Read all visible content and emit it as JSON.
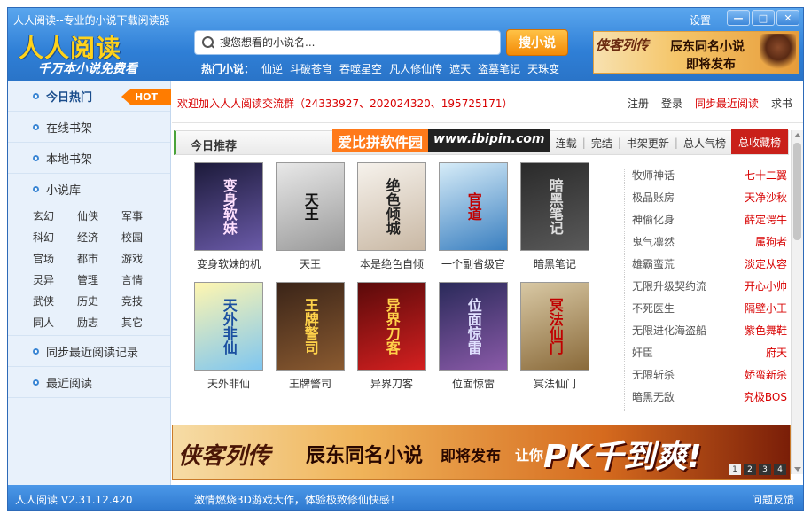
{
  "window": {
    "title": "人人阅读--专业的小说下载阅读器",
    "settings_label": "设置",
    "minimize": "—",
    "maximize": "□",
    "close": "✕"
  },
  "header": {
    "logo": "人人阅读",
    "slogan": "千万本小说免费看",
    "search_placeholder": "搜您想看的小说名...",
    "search_button": "搜小说",
    "hot_label": "热门小说：",
    "hot_words": [
      "仙逆",
      "斗破苍穹",
      "吞噬星空",
      "凡人修仙传",
      "遮天",
      "盗墓笔记",
      "天珠变"
    ],
    "ad": {
      "art": "侠客列传",
      "line1": "辰东同名小说",
      "line2": "即将发布"
    }
  },
  "sidebar": {
    "items": [
      {
        "label": "今日热门",
        "badge": "HOT"
      },
      {
        "label": "在线书架"
      },
      {
        "label": "本地书架"
      },
      {
        "label": "小说库"
      }
    ],
    "categories": [
      "玄幻",
      "仙侠",
      "军事",
      "科幻",
      "经济",
      "校园",
      "官场",
      "都市",
      "游戏",
      "灵异",
      "管理",
      "言情",
      "武侠",
      "历史",
      "竞技",
      "同人",
      "励志",
      "其它"
    ],
    "bottom_items": [
      {
        "label": "同步最近阅读记录"
      },
      {
        "label": "最近阅读"
      }
    ]
  },
  "main": {
    "notice": "欢迎加入人人阅读交流群（24333927、202024320、195725171）",
    "top_links": [
      "注册",
      "登录",
      "同步最近阅读",
      "求书"
    ],
    "rec_title": "今日推荐",
    "watermark": {
      "cn": "爱比拼软件园",
      "url": "www.ibipin.com"
    },
    "tabs": [
      "连载",
      "完结",
      "书架更新",
      "总人气榜",
      "总收藏榜"
    ],
    "books": [
      {
        "name": "变身软妹的机",
        "cover_text": "变身软妹",
        "c1": "#1c1a3a",
        "c2": "#6a5aa8",
        "fg": "#ffe0ff"
      },
      {
        "name": "天王",
        "cover_text": "天王",
        "c1": "#e8e8e8",
        "c2": "#9a9a9a",
        "fg": "#111111"
      },
      {
        "name": "本是绝色自倾",
        "cover_text": "绝色倾城",
        "c1": "#f6f2ec",
        "c2": "#c9b8a4",
        "fg": "#222222"
      },
      {
        "name": "一个副省级官",
        "cover_text": "官道",
        "c1": "#d6ecf8",
        "c2": "#3a7fc0",
        "fg": "#c00000"
      },
      {
        "name": "暗黑笔记",
        "cover_text": "暗黑笔记",
        "c1": "#2a2a2a",
        "c2": "#5a5a5a",
        "fg": "#dddddd"
      },
      {
        "name": "天外非仙",
        "cover_text": "天外非仙",
        "c1": "#fff6b0",
        "c2": "#7fc6f0",
        "fg": "#1a4fa0"
      },
      {
        "name": "王牌警司",
        "cover_text": "王牌警司",
        "c1": "#3a2418",
        "c2": "#8a5a30",
        "fg": "#ffd24a"
      },
      {
        "name": "异界刀客",
        "cover_text": "异界刀客",
        "c1": "#5a0a0a",
        "c2": "#d42020",
        "fg": "#ffd24a"
      },
      {
        "name": "位面惊雷",
        "cover_text": "位面惊雷",
        "c1": "#2a2a5a",
        "c2": "#8a5aa8",
        "fg": "#e0e0ff"
      },
      {
        "name": "冥法仙门",
        "cover_text": "冥法仙门",
        "c1": "#d8c8a4",
        "c2": "#8a6a3a",
        "fg": "#c00000"
      }
    ],
    "rankings": [
      {
        "book": "牧师神话",
        "author": "七十二翼"
      },
      {
        "book": "极品账房",
        "author": "天净沙秋"
      },
      {
        "book": "神偷化身",
        "author": "薛定谔牛"
      },
      {
        "book": "鬼气凛然",
        "author": "属狗者"
      },
      {
        "book": "雄霸蛮荒",
        "author": "淡定从容"
      },
      {
        "book": "无限升级契约流",
        "author": "开心小帅"
      },
      {
        "book": "不死医生",
        "author": "隔壁小王"
      },
      {
        "book": "无限进化海盗船",
        "author": "紫色舞鞋"
      },
      {
        "book": "奸臣",
        "author": "府天"
      },
      {
        "book": "无限斩杀",
        "author": "娇蛮新杀"
      },
      {
        "book": "暗黑无敌",
        "author": "究极BOS"
      }
    ],
    "banner": {
      "art": "侠客列传",
      "b1": "辰东同名小说",
      "b2": "即将发布",
      "b3": "让你",
      "b4": "PK千到爽!",
      "pages": [
        "1",
        "2",
        "3",
        "4"
      ]
    }
  },
  "status": {
    "version": "人人阅读 V2.31.12.420",
    "message": "激情燃烧3D游戏大作，体验极致修仙快感！",
    "feedback": "问题反馈"
  }
}
